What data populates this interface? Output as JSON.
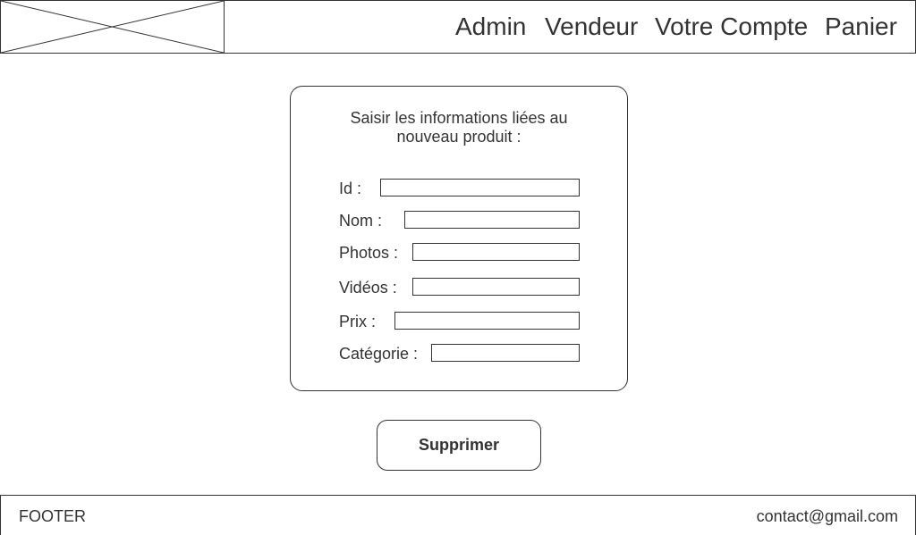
{
  "header": {
    "logo_icon": "image-placeholder-icon",
    "nav": {
      "admin": "Admin",
      "vendeur": "Vendeur",
      "compte": "Votre Compte",
      "panier": "Panier"
    }
  },
  "form": {
    "title_line1": "Saisir les informations liées au",
    "title_line2": "nouveau produit :",
    "fields": {
      "id": {
        "label": "Id :",
        "value": ""
      },
      "nom": {
        "label": "Nom :",
        "value": ""
      },
      "photos": {
        "label": "Photos :",
        "value": ""
      },
      "videos": {
        "label": "Vidéos :",
        "value": ""
      },
      "prix": {
        "label": "Prix :",
        "value": ""
      },
      "categorie": {
        "label": "Catégorie :",
        "value": ""
      }
    },
    "submit_label": "Supprimer"
  },
  "footer": {
    "left": "FOOTER",
    "right": "contact@gmail.com"
  }
}
